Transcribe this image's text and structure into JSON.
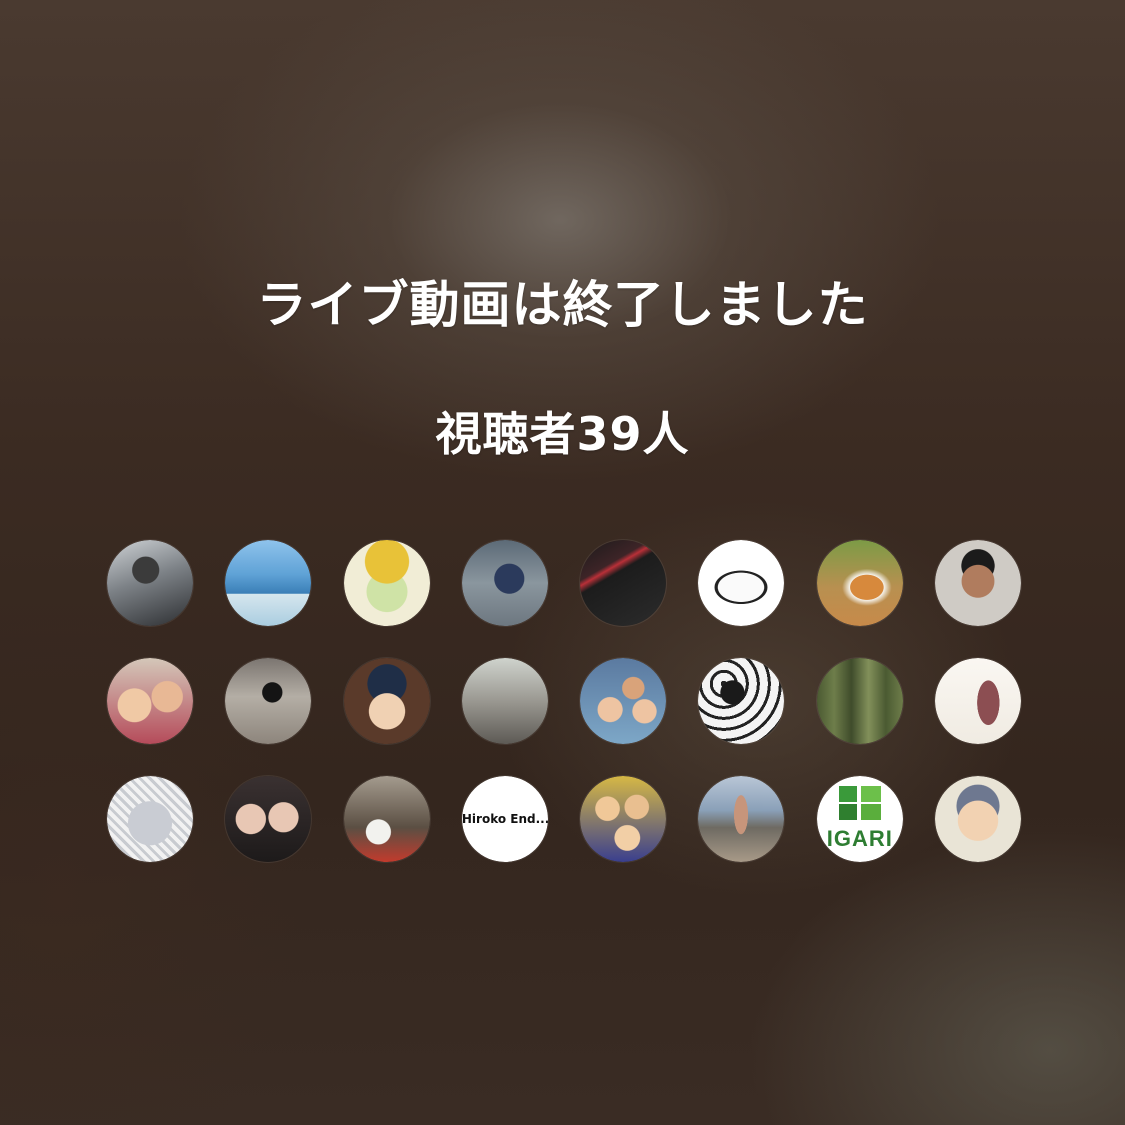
{
  "live_end": {
    "title": "ライブ動画は終了しました",
    "viewer_count": "視聴者39人"
  },
  "viewers": [
    {
      "id": 0,
      "avatar": "photo",
      "label": ""
    },
    {
      "id": 1,
      "avatar": "photo",
      "label": ""
    },
    {
      "id": 2,
      "avatar": "photo",
      "label": ""
    },
    {
      "id": 3,
      "avatar": "photo",
      "label": ""
    },
    {
      "id": 4,
      "avatar": "photo",
      "label": ""
    },
    {
      "id": 5,
      "avatar": "photo",
      "label": ""
    },
    {
      "id": 6,
      "avatar": "photo",
      "label": ""
    },
    {
      "id": 7,
      "avatar": "photo",
      "label": ""
    },
    {
      "id": 8,
      "avatar": "photo",
      "label": ""
    },
    {
      "id": 9,
      "avatar": "photo",
      "label": ""
    },
    {
      "id": 10,
      "avatar": "photo",
      "label": ""
    },
    {
      "id": 11,
      "avatar": "photo",
      "label": ""
    },
    {
      "id": 12,
      "avatar": "photo",
      "label": ""
    },
    {
      "id": 13,
      "avatar": "photo",
      "label": ""
    },
    {
      "id": 14,
      "avatar": "photo",
      "label": ""
    },
    {
      "id": 15,
      "avatar": "photo",
      "label": ""
    },
    {
      "id": 16,
      "avatar": "photo",
      "label": ""
    },
    {
      "id": 17,
      "avatar": "photo",
      "label": ""
    },
    {
      "id": 18,
      "avatar": "photo",
      "label": ""
    },
    {
      "id": 19,
      "avatar": "text",
      "label": "Hiroko End..."
    },
    {
      "id": 20,
      "avatar": "photo",
      "label": ""
    },
    {
      "id": 21,
      "avatar": "photo",
      "label": ""
    },
    {
      "id": 22,
      "avatar": "logo",
      "label": "IGARI"
    },
    {
      "id": 23,
      "avatar": "photo",
      "label": ""
    }
  ],
  "colors": {
    "text": "#ffffff",
    "background": "#3b2b22",
    "logo_green": "#2e7d32"
  }
}
